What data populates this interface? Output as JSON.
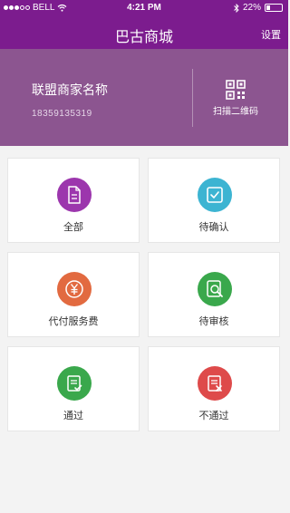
{
  "status_bar": {
    "carrier": "BELL",
    "time": "4:21 PM",
    "battery": "22%"
  },
  "nav": {
    "title": "巴古商城",
    "settings_label": "设置"
  },
  "merchant": {
    "name": "联盟商家名称",
    "phone": "18359135319",
    "scan_label": "扫描二维码"
  },
  "tiles": [
    {
      "label": "全部",
      "icon": "document-icon",
      "color": "#9c36ad"
    },
    {
      "label": "待确认",
      "icon": "check-box-icon",
      "color": "#3cb4d2"
    },
    {
      "label": "代付服务费",
      "icon": "yen-icon",
      "color": "#e26a40"
    },
    {
      "label": "待审核",
      "icon": "magnifier-doc-icon",
      "color": "#3aa84c"
    },
    {
      "label": "通过",
      "icon": "doc-check-icon",
      "color": "#3aa84c"
    },
    {
      "label": "不通过",
      "icon": "doc-x-icon",
      "color": "#de4a4a"
    }
  ]
}
